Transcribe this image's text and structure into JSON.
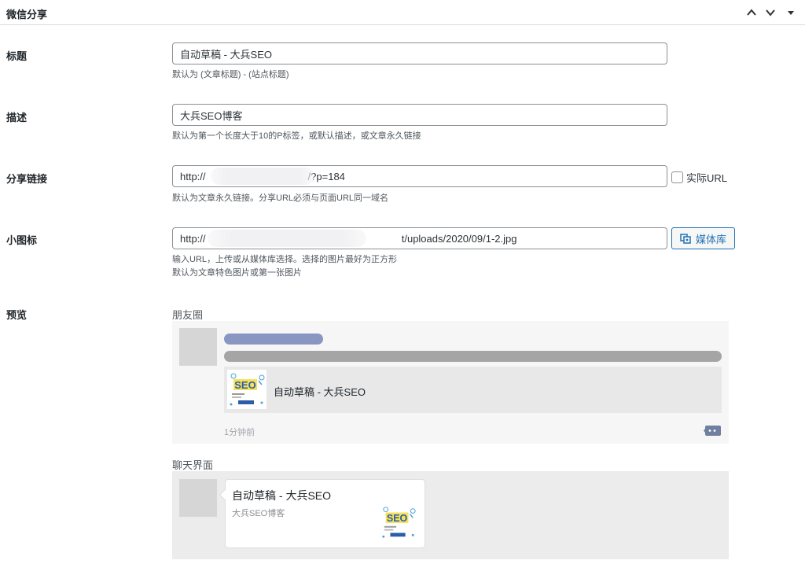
{
  "panel": {
    "title": "微信分享",
    "collapse_up_icon": "chevron-up-icon",
    "collapse_down_icon": "chevron-down-icon",
    "toggle_icon": "triangle-down-icon"
  },
  "fields": {
    "title": {
      "label": "标题",
      "value": "自动草稿 - 大兵SEO",
      "hint": "默认为 (文章标题) - (站点标题)"
    },
    "description": {
      "label": "描述",
      "value": "大兵SEO博客",
      "hint": "默认为第一个长度大于10的P标签，或默认描述，或文章永久链接"
    },
    "share_link": {
      "label": "分享链接",
      "value": "http://                                    /?p=184",
      "hint": "默认为文章永久链接。分享URL必须与页面URL同一域名",
      "checkbox_label": "实际URL"
    },
    "icon": {
      "label": "小图标",
      "value": "http://                                                                     t/uploads/2020/09/1-2.jpg",
      "hint_line1": "输入URL，上传或从媒体库选择。选择的图片最好为正方形",
      "hint_line2": "默认为文章特色图片或第一张图片",
      "media_button": "媒体库",
      "media_icon": "media-library-icon"
    }
  },
  "preview": {
    "label": "预览",
    "moments": {
      "label": "朋友圈",
      "link_title": "自动草稿 - 大兵SEO",
      "time": "1分钟前",
      "comment_icon": "comment-dots-icon"
    },
    "chat": {
      "label": "聊天界面",
      "title": "自动草稿 - 大兵SEO",
      "desc": "大兵SEO博客"
    },
    "thumb_text": "SEO"
  },
  "colors": {
    "accent": "#2271b1",
    "name_bar": "#8996c2"
  }
}
